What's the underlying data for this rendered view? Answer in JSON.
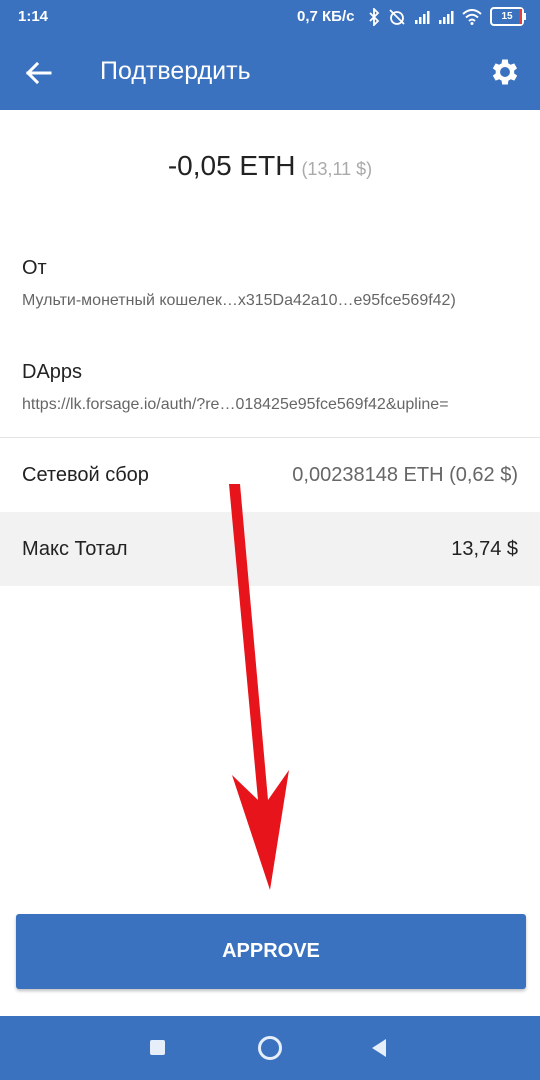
{
  "status_bar": {
    "time": "1:14",
    "speed": "0,7 КБ/с",
    "battery": "15"
  },
  "app_bar": {
    "title": "Подтвердить"
  },
  "amount": {
    "value": "-0,05 ETH",
    "usd": "(13,11 $)"
  },
  "from": {
    "label": "От",
    "value": "Мульти-монетный кошелек…x315Da42a10…e95fce569f42)"
  },
  "dapps": {
    "label": "DApps",
    "value": "https://lk.forsage.io/auth/?re…018425e95fce569f42&upline="
  },
  "network_fee": {
    "label": "Сетевой сбор",
    "value": "0,00238148 ETH (0,62 $)"
  },
  "max_total": {
    "label": "Макс Тотал",
    "value": "13,74 $"
  },
  "approve_label": "APPROVE",
  "colors": {
    "primary": "#3a72bf",
    "annotation_arrow": "#e8141b"
  }
}
